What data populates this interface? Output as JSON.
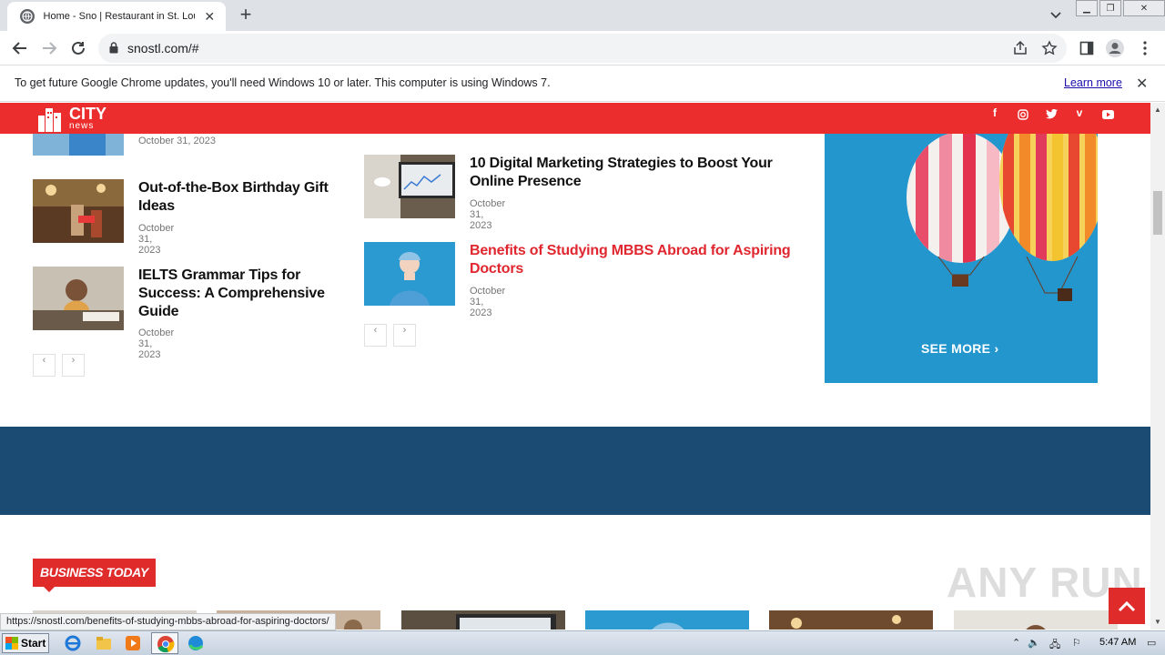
{
  "browser": {
    "tab_title": "Home - Sno | Restaurant in St. Louis",
    "url": "snostl.com/#",
    "infobar_text": "To get future Google Chrome updates, you'll need Windows 10 or later. This computer is using Windows 7.",
    "infobar_link": "Learn more",
    "status_url": "https://snostl.com/benefits-of-studying-mbbs-abroad-for-aspiring-doctors/"
  },
  "site": {
    "logo_city": "CITY",
    "logo_news": "news",
    "social": [
      "facebook-icon",
      "instagram-icon",
      "twitter-icon",
      "vimeo-icon",
      "youtube-icon"
    ]
  },
  "left_column": {
    "partial_date": "October 31, 2023",
    "articles": [
      {
        "title": "Out-of-the-Box Birthday Gift Ideas",
        "date": "October 31, 2023"
      },
      {
        "title": "IELTS Grammar Tips for Success: A Comprehensive Guide",
        "date": "October 31, 2023"
      }
    ],
    "pager_prev": "‹",
    "pager_next": "›"
  },
  "middle_column": {
    "articles": [
      {
        "title": "10 Digital Marketing Strategies to Boost Your Online Presence",
        "date": "October 31, 2023",
        "active": false
      },
      {
        "title": "Benefits of Studying MBBS Abroad for Aspiring Doctors",
        "date": "October 31, 2023",
        "active": true
      }
    ],
    "pager_prev": "‹",
    "pager_next": "›"
  },
  "ad": {
    "cta": "SEE MORE ›"
  },
  "business": {
    "label": "BUSINESS TODAY"
  },
  "watermark": "ANY RUN",
  "taskbar": {
    "start_label": "Start",
    "clock": "5:47 AM"
  },
  "colors": {
    "brand_red": "#ec2d2d",
    "band_blue": "#1b4a73",
    "ad_blue": "#2396cd"
  }
}
